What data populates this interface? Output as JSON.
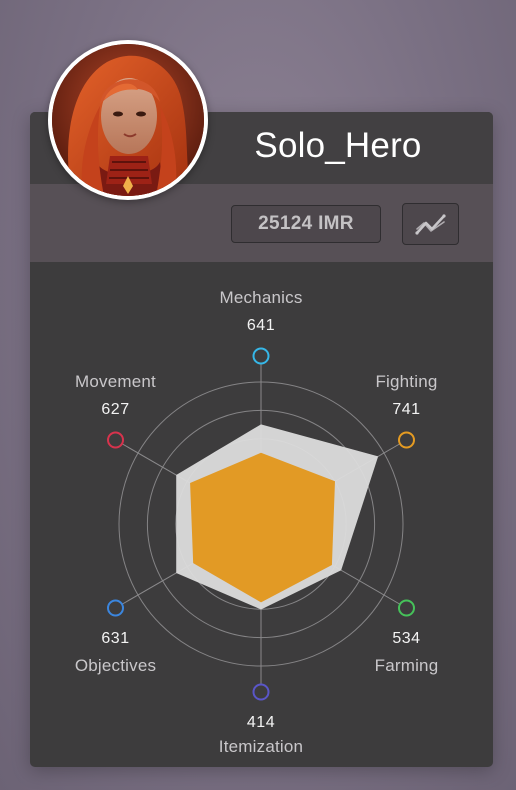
{
  "player": {
    "name": "Solo_Hero",
    "rating": "25124 IMR"
  },
  "icons": {
    "avatar": "hero-portrait",
    "trend": "trend-chart-icon"
  },
  "colors": {
    "background": "#7a7083",
    "card": "#3d3c3d",
    "header": "#424042",
    "subheader": "#575056",
    "radar_fill": "#e29a25",
    "radar_max": "#dadada",
    "grid": "#8a898b"
  },
  "chart_data": {
    "type": "radar",
    "axes": [
      {
        "label": "Mechanics",
        "value": 641,
        "color": "#36b7e8"
      },
      {
        "label": "Fighting",
        "value": 741,
        "color": "#e59b22"
      },
      {
        "label": "Farming",
        "value": 534,
        "color": "#46c25a"
      },
      {
        "label": "Itemization",
        "value": 414,
        "color": "#5a56c9"
      },
      {
        "label": "Objectives",
        "value": 631,
        "color": "#3b86df"
      },
      {
        "label": "Movement",
        "value": 627,
        "color": "#d8334d"
      }
    ],
    "max_values": [
      0.56,
      0.76,
      0.52,
      0.48,
      0.55,
      0.55
    ],
    "fill_values": [
      0.4,
      0.48,
      0.46,
      0.44,
      0.44,
      0.46
    ],
    "rings": 5,
    "grid": true
  }
}
